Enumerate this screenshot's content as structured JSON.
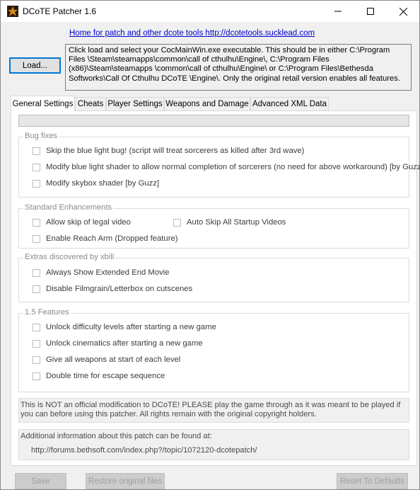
{
  "window": {
    "title": "DCoTE Patcher 1.6",
    "controls": {
      "minimize": "minimize-icon",
      "maximize": "maximize-icon",
      "close": "close-icon"
    }
  },
  "header": {
    "home_link": "Home for patch and other dcote tools http://dcotetools.sucklead.com",
    "load_button": "Load...",
    "info_text": "Click load and select your CocMainWin.exe executable. This should be in either C:\\Program Files \\Steam\\steamapps\\common\\call of cthulhu\\Engine\\, C:\\Program Files (x86)\\Steam\\steamapps \\common\\call of cthulhu\\Engine\\ or C:\\Program Files\\Bethesda Softworks\\Call Of Cthulhu DCoTE \\Engine\\. Only the original retail version enables all features."
  },
  "tabs": [
    "General Settings",
    "Cheats",
    "Player Settings",
    "Weapons and Damage",
    "Advanced XML Data"
  ],
  "active_tab": "General Settings",
  "groups": {
    "bug_fixes": {
      "label": "Bug fixes",
      "items": [
        "Skip the blue light bug! (script will treat sorcerers as killed after 3rd wave)",
        "Modify blue light shader to allow normal completion of sorcerers (no need for above workaround) [by Guzz]",
        "Modify skybox shader [by Guzz]"
      ]
    },
    "standard": {
      "label": "Standard Enhancements",
      "items": [
        "Allow skip of legal video",
        "Auto Skip All Startup Videos",
        "Enable Reach Arm (Dropped feature)"
      ]
    },
    "extras": {
      "label": "Extras discovered by xbill",
      "items": [
        "Always Show Extended End Movie",
        "Disable Filmgrain/Letterbox on cutscenes"
      ]
    },
    "features15": {
      "label": "1.5 Features",
      "items": [
        "Unlock difficulty levels after starting a new game",
        "Unlock cinematics after starting a new game",
        "Give all weapons at start of each level",
        "Double time for escape sequence"
      ]
    }
  },
  "notes": {
    "disclaimer": "This is NOT an official modification to DCoTE!  PLEASE play the game through as it was meant to be played if you can before using this patcher.  All rights remain with the original copyright holders.",
    "additional_label": "Additional information about this patch can be found at:",
    "additional_url": "http://forums.bethsoft.com/index.php?/topic/1072120-dcotepatch/"
  },
  "footer": {
    "save": "Save",
    "restore": "Restore original files",
    "reset": "Reset To Defaults"
  }
}
